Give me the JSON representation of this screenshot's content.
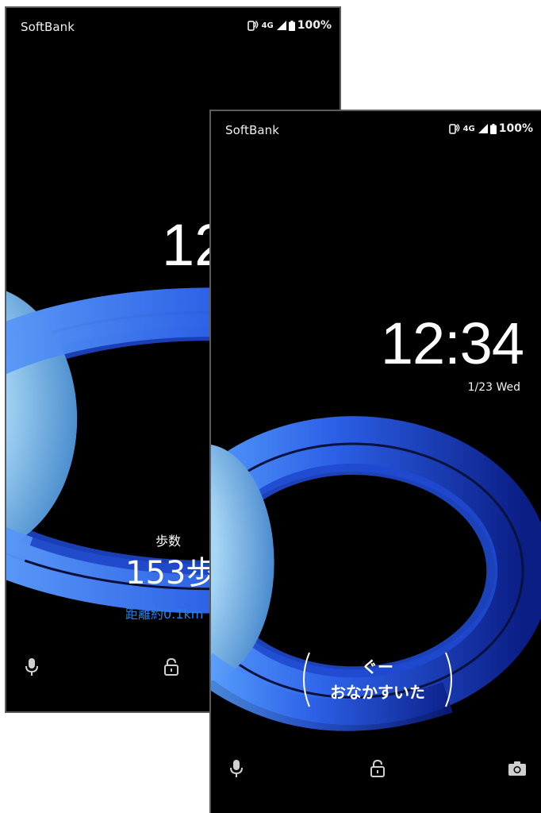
{
  "back_screen": {
    "carrier": "SoftBank",
    "network": "4G",
    "battery": "100%",
    "clock_partial": "12",
    "steps_label": "歩数",
    "steps_value": "153歩",
    "distance": "距離約0.1km"
  },
  "front_screen": {
    "carrier": "SoftBank",
    "network": "4G",
    "battery": "100%",
    "clock": "12:34",
    "date": "1/23 Wed",
    "bubble_line1": "ぐー",
    "bubble_line2": "おなかすいた"
  },
  "icons": {
    "voice": "microphone-icon",
    "unlock": "lock-icon",
    "camera": "camera-icon",
    "nfc": "nfc-icon",
    "signal": "signal-icon",
    "battery": "battery-icon"
  },
  "colors": {
    "background": "#000000",
    "distance_text": "#2c7fe6",
    "ring_blue": "#1f4fd8",
    "planet_blue": "#9fd0f2"
  }
}
